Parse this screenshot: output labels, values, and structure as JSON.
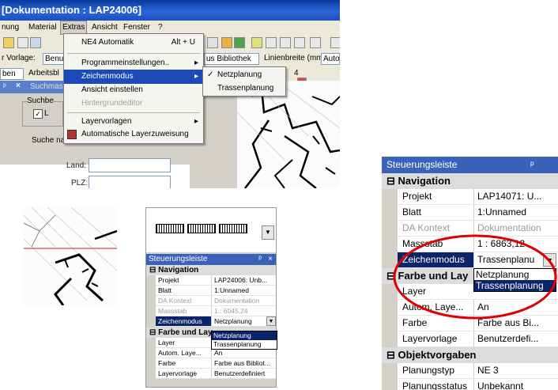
{
  "window": {
    "title": "[Dokumentation : LAP24006]"
  },
  "menubar": {
    "items": [
      "nung",
      "Material",
      "Extras",
      "Ansicht",
      "Fenster",
      "?"
    ]
  },
  "toolbar": {
    "vorlage_label": "r Vorlage:",
    "vorlage_value": "Benu",
    "bibliothek_value": "us Bibliothek",
    "linienbreite_label": "Linienbreite (mm):",
    "linienbreite_value": "Auto",
    "row3_a": "ben",
    "row3_b": "Arbeitsbl",
    "row3_c": "4"
  },
  "left_panel": {
    "tab_label": "Suchmas",
    "group_label": "Suchbe",
    "checkbox_label": "L",
    "suche_label": "Suche na",
    "land_label": "Land:",
    "plz_label": "PLZ:"
  },
  "extras_menu": {
    "items": [
      {
        "label": "NE4 Automatik",
        "shortcut": "Alt + U"
      },
      {
        "label": "Programmeinstellungen.."
      },
      {
        "label": "Zeichenmodus"
      },
      {
        "label": "Ansicht einstellen"
      },
      {
        "label": "Hintergrundeditor"
      },
      {
        "label": "Layervorlagen"
      },
      {
        "label": "Automatische Layerzuweisung"
      }
    ]
  },
  "sub_menu": {
    "items": [
      "Netzplanung",
      "Trassenplanung"
    ]
  },
  "mid_panel": {
    "title": "Steuerungsleiste",
    "pin": "ᵖ",
    "close": "×",
    "cat_navigation": "Navigation",
    "rows": [
      {
        "key": "Projekt",
        "value": "LAP24006: Unb..."
      },
      {
        "key": "Blatt",
        "value": "1:Unnamed"
      },
      {
        "key": "DA Kontext",
        "value": "Dokumentation"
      },
      {
        "key": "Massstab",
        "value": "1 : 6045,24"
      },
      {
        "key": "Zeichenmodus",
        "value": "Netzplanung"
      }
    ],
    "cat_farbe": "Farbe und Lay",
    "rows2": [
      {
        "key": "Layer",
        "value": ""
      },
      {
        "key": "Autom. Laye...",
        "value": "An"
      },
      {
        "key": "Farbe",
        "value": "Farbe aus Bibliot..."
      },
      {
        "key": "Layervorlage",
        "value": "Benutzerdefiniert"
      }
    ],
    "dropdown": [
      "Netzplanung",
      "Trassenplanung"
    ]
  },
  "right_panel": {
    "title": "Steuerungsleiste",
    "pin": "ᵖ",
    "cat_navigation": "Navigation",
    "rows": [
      {
        "key": "Projekt",
        "value": "LAP14071: U..."
      },
      {
        "key": "Blatt",
        "value": "1:Unnamed"
      },
      {
        "key": "DA Kontext",
        "value": "Dokumentation"
      },
      {
        "key": "Massstab",
        "value": "1 : 6863,12"
      },
      {
        "key": "Zeichenmodus",
        "value": "Trassenplanu"
      }
    ],
    "cat_farbe": "Farbe und Lay",
    "rows2": [
      {
        "key": "Layer",
        "value": ""
      },
      {
        "key": "Autom. Laye...",
        "value": "An"
      },
      {
        "key": "Farbe",
        "value": "Farbe aus Bi..."
      },
      {
        "key": "Layervorlage",
        "value": "Benutzerdefi..."
      }
    ],
    "cat_objekt": "Objektvorgaben",
    "rows3": [
      {
        "key": "Planungstyp",
        "value": "NE 3"
      },
      {
        "key": "Planungsstatus",
        "value": "Unbekannt"
      }
    ],
    "dropdown": [
      "Netzplanung",
      "Trassenplanung"
    ]
  },
  "colors": {
    "highlight": "#1c4bb8",
    "annotation_ellipse": "#e00000",
    "title_blue": "#3a62b8"
  }
}
